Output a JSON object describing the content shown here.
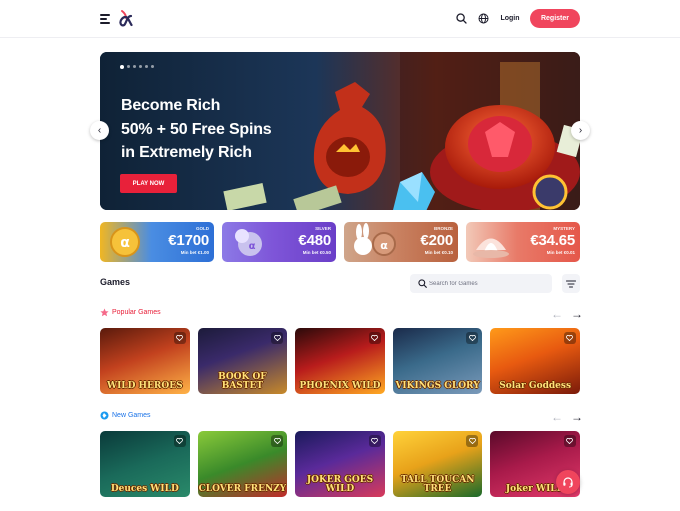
{
  "header": {
    "login_label": "Login",
    "register_label": "Register",
    "accent": "#f0455d"
  },
  "hero": {
    "lines": [
      "Become Rich",
      "50% + 50 Free Spins",
      "in Extremely Rich"
    ],
    "cta_label": "PLAY NOW",
    "slide_count": 6,
    "active_slide": 1
  },
  "jackpots": [
    {
      "tier": "GOLD",
      "amount": "€1700",
      "min_bet": "Min bet €1.00"
    },
    {
      "tier": "SILVER",
      "amount": "€480",
      "min_bet": "Min bet €0.50"
    },
    {
      "tier": "BRONZE",
      "amount": "€200",
      "min_bet": "Min bet €0.10"
    },
    {
      "tier": "MYSTERY",
      "amount": "€34.65",
      "min_bet": "Min bet €0.01"
    }
  ],
  "games_section": {
    "title": "Games",
    "search_placeholder": "Search for Games"
  },
  "popular": {
    "label": "Popular Games",
    "games": [
      {
        "title": "WILD HEROES"
      },
      {
        "title": "BOOK OF BASTET"
      },
      {
        "title": "PHOENIX WILD"
      },
      {
        "title": "VIKINGS GLORY"
      },
      {
        "title": "Solar Goddess"
      }
    ]
  },
  "new_games": {
    "label": "New Games",
    "games": [
      {
        "title": "Deuces WILD"
      },
      {
        "title": "CLOVER FRENZY"
      },
      {
        "title": "JOKER GOES WILD"
      },
      {
        "title": "TALL TOUCAN TREE"
      },
      {
        "title": "Joker WILD"
      }
    ]
  }
}
